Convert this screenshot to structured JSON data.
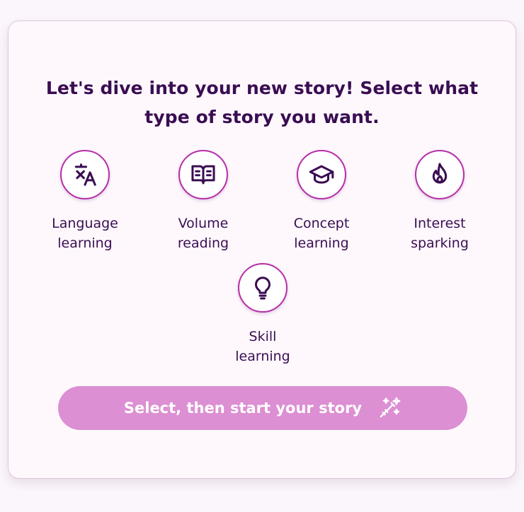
{
  "heading": {
    "line1": "Let's dive into your new story! Select what",
    "line2": "type of story you want."
  },
  "options": [
    {
      "icon": "translate-icon",
      "label_line1": "Language",
      "label_line2": "learning"
    },
    {
      "icon": "book-icon",
      "label_line1": "Volume",
      "label_line2": "reading"
    },
    {
      "icon": "graduation-cap-icon",
      "label_line1": "Concept",
      "label_line2": "learning"
    },
    {
      "icon": "flame-icon",
      "label_line1": "Interest",
      "label_line2": "sparking"
    },
    {
      "icon": "lightbulb-icon",
      "label_line1": "Skill",
      "label_line2": "learning"
    }
  ],
  "start_button": {
    "label": "Select, then start your story",
    "icon": "magic-wand-icon"
  },
  "colors": {
    "accent_border": "#b52fa8",
    "text": "#3a0d52",
    "button_bg": "#dc8fd3",
    "card_bg": "#fef8fd"
  }
}
